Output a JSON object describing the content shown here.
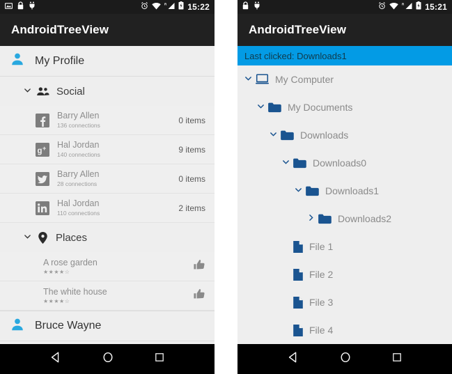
{
  "left_phone": {
    "status_bar": {
      "icons_left": [
        "screenshot-icon",
        "lock-icon",
        "usb-debug-icon"
      ],
      "icons_right": [
        "alarm-icon",
        "wifi-icon",
        "signal-roaming-icon",
        "battery-charging-icon"
      ],
      "time": "15:22"
    },
    "app_bar": {
      "title": "AndroidTreeView"
    },
    "tree": {
      "profile_root": {
        "label": "My Profile",
        "icon": "person-icon"
      },
      "social_group": {
        "label": "Social",
        "icon": "people-icon",
        "chevron": "chevron-down-icon"
      },
      "social_items": [
        {
          "icon": "facebook-icon",
          "glyph": "f",
          "name": "Barry Allen",
          "sub": "136 connections",
          "right": "0 items"
        },
        {
          "icon": "google-plus-icon",
          "glyph": "g+",
          "name": "Hal Jordan",
          "sub": "140 connections",
          "right": "9 items"
        },
        {
          "icon": "twitter-icon",
          "glyph": "t",
          "name": "Barry Allen",
          "sub": "28 connections",
          "right": "0 items"
        },
        {
          "icon": "linkedin-icon",
          "glyph": "in",
          "name": "Hal Jordan",
          "sub": "110 connections",
          "right": "2 items"
        }
      ],
      "places_group": {
        "label": "Places",
        "icon": "location-pin-icon",
        "chevron": "chevron-down-icon"
      },
      "places_items": [
        {
          "name": "A rose garden",
          "stars": "★★★★☆",
          "right_icon": "thumbs-up-icon"
        },
        {
          "name": "The white house",
          "stars": "★★★★☆",
          "right_icon": "thumbs-up-icon"
        }
      ],
      "bruce_root": {
        "label": "Bruce Wayne",
        "icon": "person-icon"
      }
    },
    "nav_bar": {
      "back": "back-triangle-icon",
      "home": "home-circle-icon",
      "recents": "recents-square-icon"
    }
  },
  "right_phone": {
    "status_bar": {
      "icons_left": [
        "lock-icon",
        "usb-debug-icon"
      ],
      "icons_right": [
        "alarm-icon",
        "wifi-icon",
        "signal-roaming-icon",
        "battery-charging-icon"
      ],
      "time": "15:21"
    },
    "app_bar": {
      "title": "AndroidTreeView"
    },
    "banner": {
      "text": "Last clicked: Downloads1",
      "color": "#039BE5"
    },
    "tree_nodes": [
      {
        "label": "My Computer",
        "icon": "computer-icon",
        "chevron": "chevron-down-icon",
        "indent": 0
      },
      {
        "label": "My Documents",
        "icon": "folder-icon",
        "chevron": "chevron-down-icon",
        "indent": 1
      },
      {
        "label": "Downloads",
        "icon": "folder-icon",
        "chevron": "chevron-down-icon",
        "indent": 2
      },
      {
        "label": "Downloads0",
        "icon": "folder-icon",
        "chevron": "chevron-down-icon",
        "indent": 3
      },
      {
        "label": "Downloads1",
        "icon": "folder-icon",
        "chevron": "chevron-down-icon",
        "indent": 4
      },
      {
        "label": "Downloads2",
        "icon": "folder-icon",
        "chevron": "chevron-right-icon",
        "indent": 5
      },
      {
        "label": "File 1",
        "icon": "file-icon",
        "chevron": "none",
        "indent": 3
      },
      {
        "label": "File 2",
        "icon": "file-icon",
        "chevron": "none",
        "indent": 3
      },
      {
        "label": "File 3",
        "icon": "file-icon",
        "chevron": "none",
        "indent": 3
      },
      {
        "label": "File 4",
        "icon": "file-icon",
        "chevron": "none",
        "indent": 3
      }
    ],
    "nav_bar": {
      "back": "back-triangle-icon",
      "home": "home-circle-icon",
      "recents": "recents-square-icon"
    }
  },
  "colors": {
    "app_bar": "#212121",
    "status_bar": "#1b1b1b",
    "banner": "#039BE5",
    "content_bg": "#eeeeee",
    "accent_person": "#29A8DF",
    "tree_blue": "#1A5490"
  }
}
